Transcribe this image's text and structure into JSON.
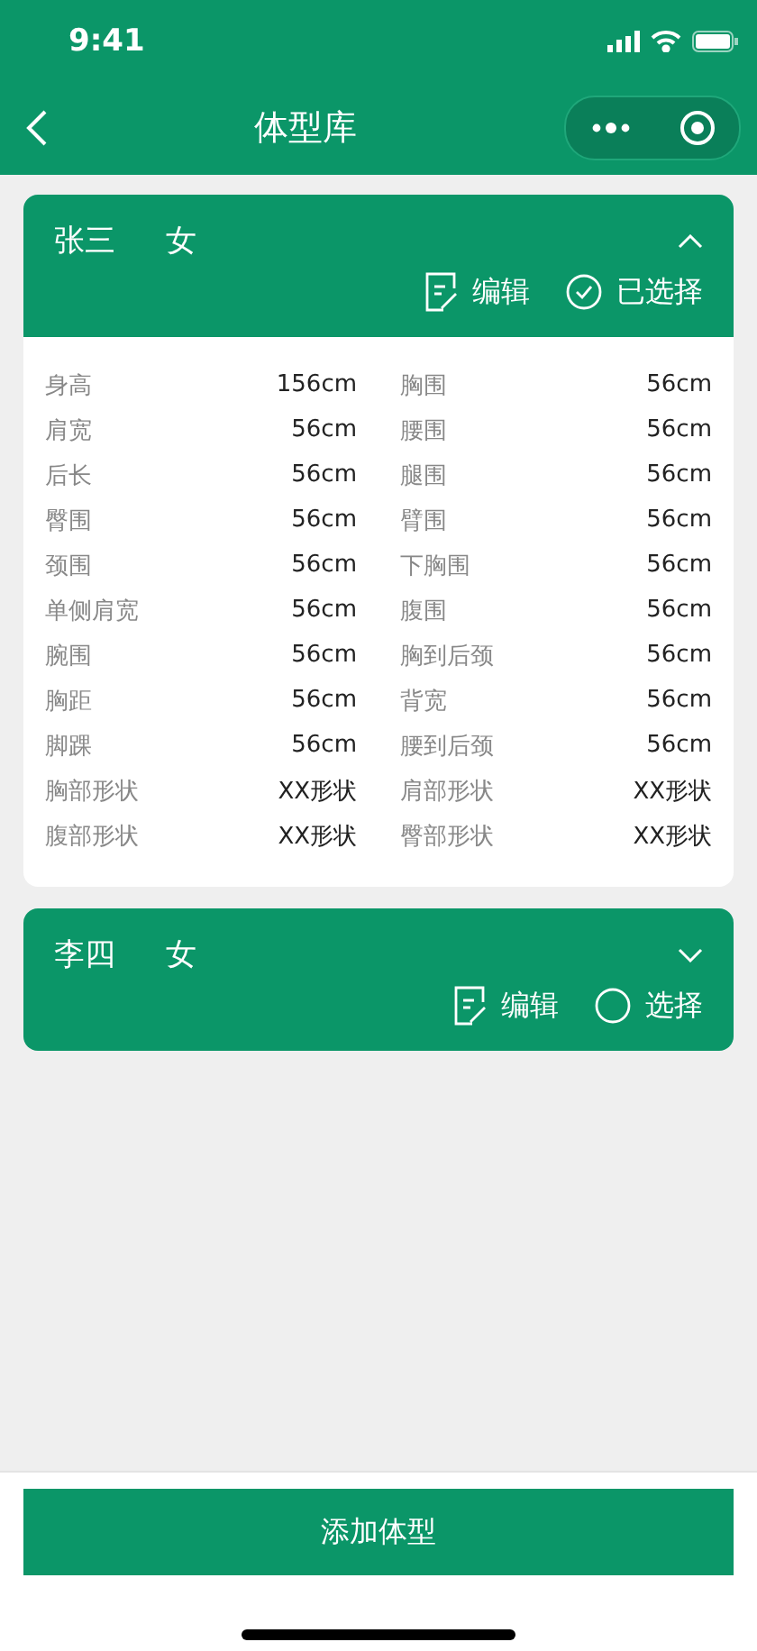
{
  "status_bar": {
    "time": "9:41"
  },
  "nav": {
    "title": "体型库"
  },
  "profiles": [
    {
      "name": "张三",
      "gender": "女",
      "expanded": true,
      "selected": true,
      "edit_label": "编辑",
      "select_label": "已选择",
      "measurements": [
        {
          "label": "身高",
          "value": "156cm"
        },
        {
          "label": "胸围",
          "value": "56cm"
        },
        {
          "label": "肩宽",
          "value": "56cm"
        },
        {
          "label": "腰围",
          "value": "56cm"
        },
        {
          "label": "后长",
          "value": "56cm"
        },
        {
          "label": "腿围",
          "value": "56cm"
        },
        {
          "label": "臀围",
          "value": "56cm"
        },
        {
          "label": "臂围",
          "value": "56cm"
        },
        {
          "label": "颈围",
          "value": "56cm"
        },
        {
          "label": "下胸围",
          "value": "56cm"
        },
        {
          "label": "单侧肩宽",
          "value": "56cm"
        },
        {
          "label": "腹围",
          "value": "56cm"
        },
        {
          "label": "腕围",
          "value": "56cm"
        },
        {
          "label": "胸到后颈",
          "value": "56cm"
        },
        {
          "label": "胸距",
          "value": "56cm"
        },
        {
          "label": "背宽",
          "value": "56cm"
        },
        {
          "label": "脚踝",
          "value": "56cm"
        },
        {
          "label": "腰到后颈",
          "value": "56cm"
        },
        {
          "label": "胸部形状",
          "value": "XX形状"
        },
        {
          "label": "肩部形状",
          "value": "XX形状"
        },
        {
          "label": "腹部形状",
          "value": "XX形状"
        },
        {
          "label": "臀部形状",
          "value": "XX形状"
        }
      ]
    },
    {
      "name": "李四",
      "gender": "女",
      "expanded": false,
      "selected": false,
      "edit_label": "编辑",
      "select_label": "选择"
    }
  ],
  "add_button": "添加体型"
}
